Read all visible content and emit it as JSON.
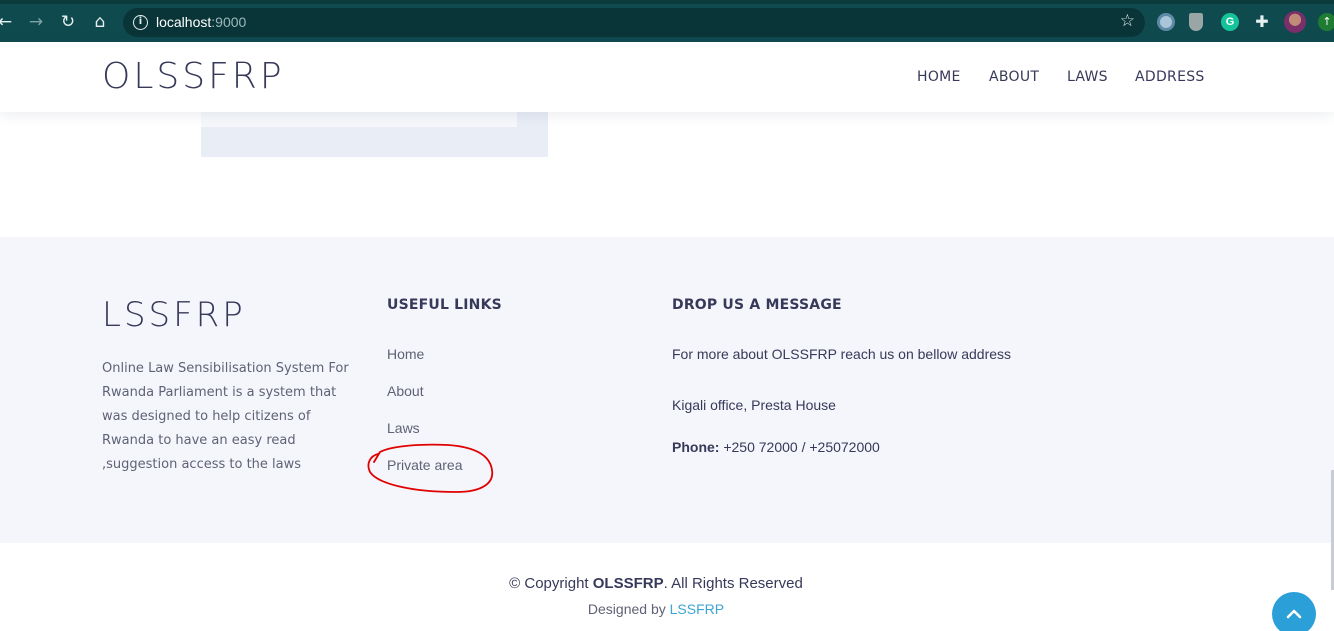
{
  "browser": {
    "url_host": "localhost",
    "url_port": ":9000",
    "icons": [
      "back-arrow-icon",
      "forward-arrow-icon",
      "reload-icon",
      "home-icon",
      "info-icon",
      "star-icon",
      "extension-icon",
      "shield-icon",
      "grammarly-icon",
      "puzzle-icon",
      "profile-avatar",
      "update-icon"
    ],
    "grammarly_letter": "G"
  },
  "header": {
    "logo": "OLSSFRP",
    "nav": [
      "HOME",
      "ABOUT",
      "LAWS",
      "ADDRESS"
    ]
  },
  "footer": {
    "logo": "LSSFRP",
    "description": "Online Law Sensibilisation System For Rwanda Parliament is a system that was designed to help citizens of Rwanda to have an easy read ,suggestion access to the laws",
    "useful_links_title": "USEFUL LINKS",
    "useful_links": [
      "Home",
      "About",
      "Laws",
      "Private area"
    ],
    "message_title": "DROP US A MESSAGE",
    "message_intro": "For more about OLSSFRP reach us on bellow address",
    "office": "Kigali office, Presta House",
    "phone_label": "Phone:",
    "phone_value": " +250 72000 / +25072000"
  },
  "bottom": {
    "copyright_prefix": "© Copyright ",
    "copyright_brand": "OLSSFRP",
    "copyright_suffix": ". All Rights Reserved",
    "designed_prefix": "Designed by ",
    "designed_link": "LSSFRP"
  },
  "colors": {
    "browser_bar": "#0f4a4e",
    "brand_text": "#37395a",
    "footer_bg": "#f4f6fb",
    "accent_blue": "#2b9fd8",
    "annotation_red": "#e00000"
  }
}
